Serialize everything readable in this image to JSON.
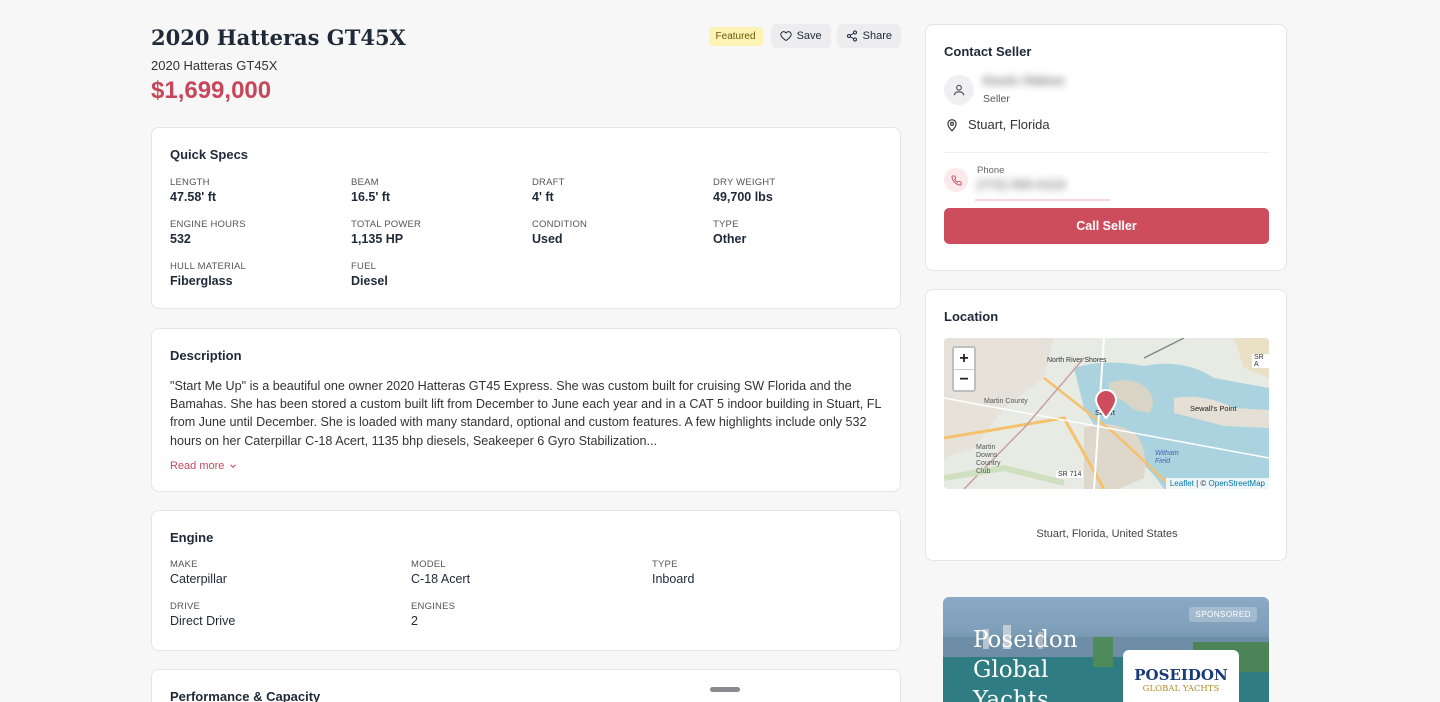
{
  "listing": {
    "title": "2020 Hatteras GT45X",
    "subtitle": "2020 Hatteras GT45X",
    "price": "$1,699,000",
    "featured_badge": "Featured",
    "save_label": "Save",
    "share_label": "Share"
  },
  "quick_specs": {
    "heading": "Quick Specs",
    "items": [
      {
        "label": "LENGTH",
        "value": "47.58' ft"
      },
      {
        "label": "BEAM",
        "value": "16.5' ft"
      },
      {
        "label": "DRAFT",
        "value": "4' ft"
      },
      {
        "label": "DRY WEIGHT",
        "value": "49,700 lbs"
      },
      {
        "label": "ENGINE HOURS",
        "value": "532"
      },
      {
        "label": "TOTAL POWER",
        "value": "1,135 HP"
      },
      {
        "label": "CONDITION",
        "value": "Used"
      },
      {
        "label": "TYPE",
        "value": "Other"
      },
      {
        "label": "HULL MATERIAL",
        "value": "Fiberglass"
      },
      {
        "label": "FUEL",
        "value": "Diesel"
      }
    ]
  },
  "description": {
    "heading": "Description",
    "text": "\"Start Me Up\" is a beautiful one owner 2020 Hatteras GT45 Express. She was custom built for cruising SW Florida and the Bamahas. She has been stored a custom built lift from December to June each year and in a CAT 5 indoor building in Stuart, FL from June until December. She is loaded with many standard, optional and custom features. A few highlights include only 532 hours on her Caterpillar C-18 Acert, 1135 bhp diesels, Seakeeper 6 Gyro Stabilization...",
    "read_more": "Read more"
  },
  "engine": {
    "heading": "Engine",
    "items": [
      {
        "label": "MAKE",
        "value": "Caterpillar"
      },
      {
        "label": "MODEL",
        "value": "C-18 Acert"
      },
      {
        "label": "TYPE",
        "value": "Inboard"
      },
      {
        "label": "DRIVE",
        "value": "Direct Drive"
      },
      {
        "label": "ENGINES",
        "value": "2"
      }
    ]
  },
  "performance": {
    "heading": "Performance & Capacity"
  },
  "contact": {
    "heading": "Contact Seller",
    "seller_name": "Kevin Vlahos",
    "seller_role": "Seller",
    "location": "Stuart, Florida",
    "phone_label": "Phone",
    "phone_value": "(772) 555-0123",
    "call_button": "Call Seller"
  },
  "location_card": {
    "heading": "Location",
    "caption": "Stuart, Florida, United States",
    "zoom_in": "+",
    "zoom_out": "−",
    "map_labels": {
      "north_river_shores": "North River Shores",
      "stuart": "Stuart",
      "sewalls_point": "Sewall's Point",
      "martin_county": "Martin County",
      "martin_downs": "Martin Downs Country Club",
      "witham_field": "Witham Field",
      "sr714": "SR 714",
      "sr_a": "SR A"
    },
    "attribution_leaflet": "Leaflet",
    "attribution_sep": " | © ",
    "attribution_osm": "OpenStreetMap"
  },
  "ad": {
    "sponsored": "SPONSORED",
    "title_line1": "Poseidon",
    "title_line2": "Global",
    "title_line3": "Yachts",
    "logo_line1": "POSEIDON",
    "logo_line2": "GLOBAL YACHTS"
  },
  "colors": {
    "accent": "#c7475a",
    "button": "#cd4d5d",
    "featured_bg": "#fdf3b4"
  }
}
